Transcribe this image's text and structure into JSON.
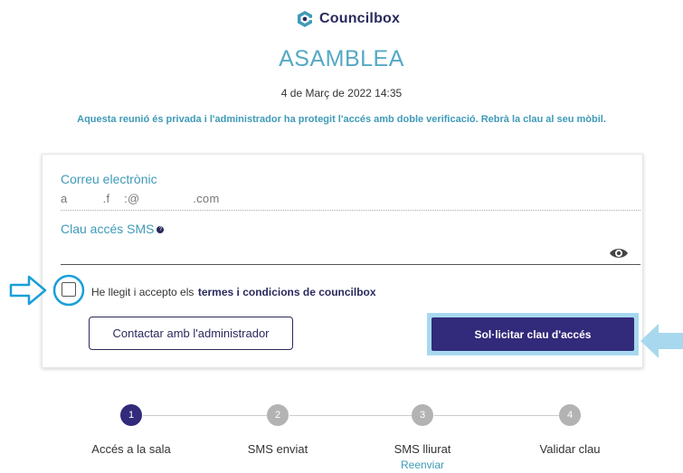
{
  "header": {
    "brand": "Councilbox",
    "title": "ASAMBLEA",
    "date": "4 de Març de 2022 14:35",
    "notice": "Aquesta reunió és privada i l'administrador ha protegit l'accés amb doble verificació. Rebrà la clau al seu mòbil."
  },
  "form": {
    "email_label": "Correu electrònic",
    "email_value": "a          .f    :@               .com",
    "sms_label": "Clau accés SMS",
    "sms_info": "?",
    "sms_value": ""
  },
  "terms": {
    "text": "He llegit i accepto els",
    "link": "termes i condicions de councilbox"
  },
  "buttons": {
    "contact": "Contactar amb l'administrador",
    "request": "Sol·licitar clau d'accés"
  },
  "steps": [
    {
      "number": "1",
      "label": "Accés a la sala"
    },
    {
      "number": "2",
      "label": "SMS enviat"
    },
    {
      "number": "3",
      "label": "SMS lliurat"
    },
    {
      "number": "4",
      "label": "Validar clau"
    }
  ],
  "resend_link": "Reenviar",
  "colors": {
    "brand_dark": "#322a7a",
    "accent": "#3f9ab8",
    "annotation": "#18a0d8"
  }
}
